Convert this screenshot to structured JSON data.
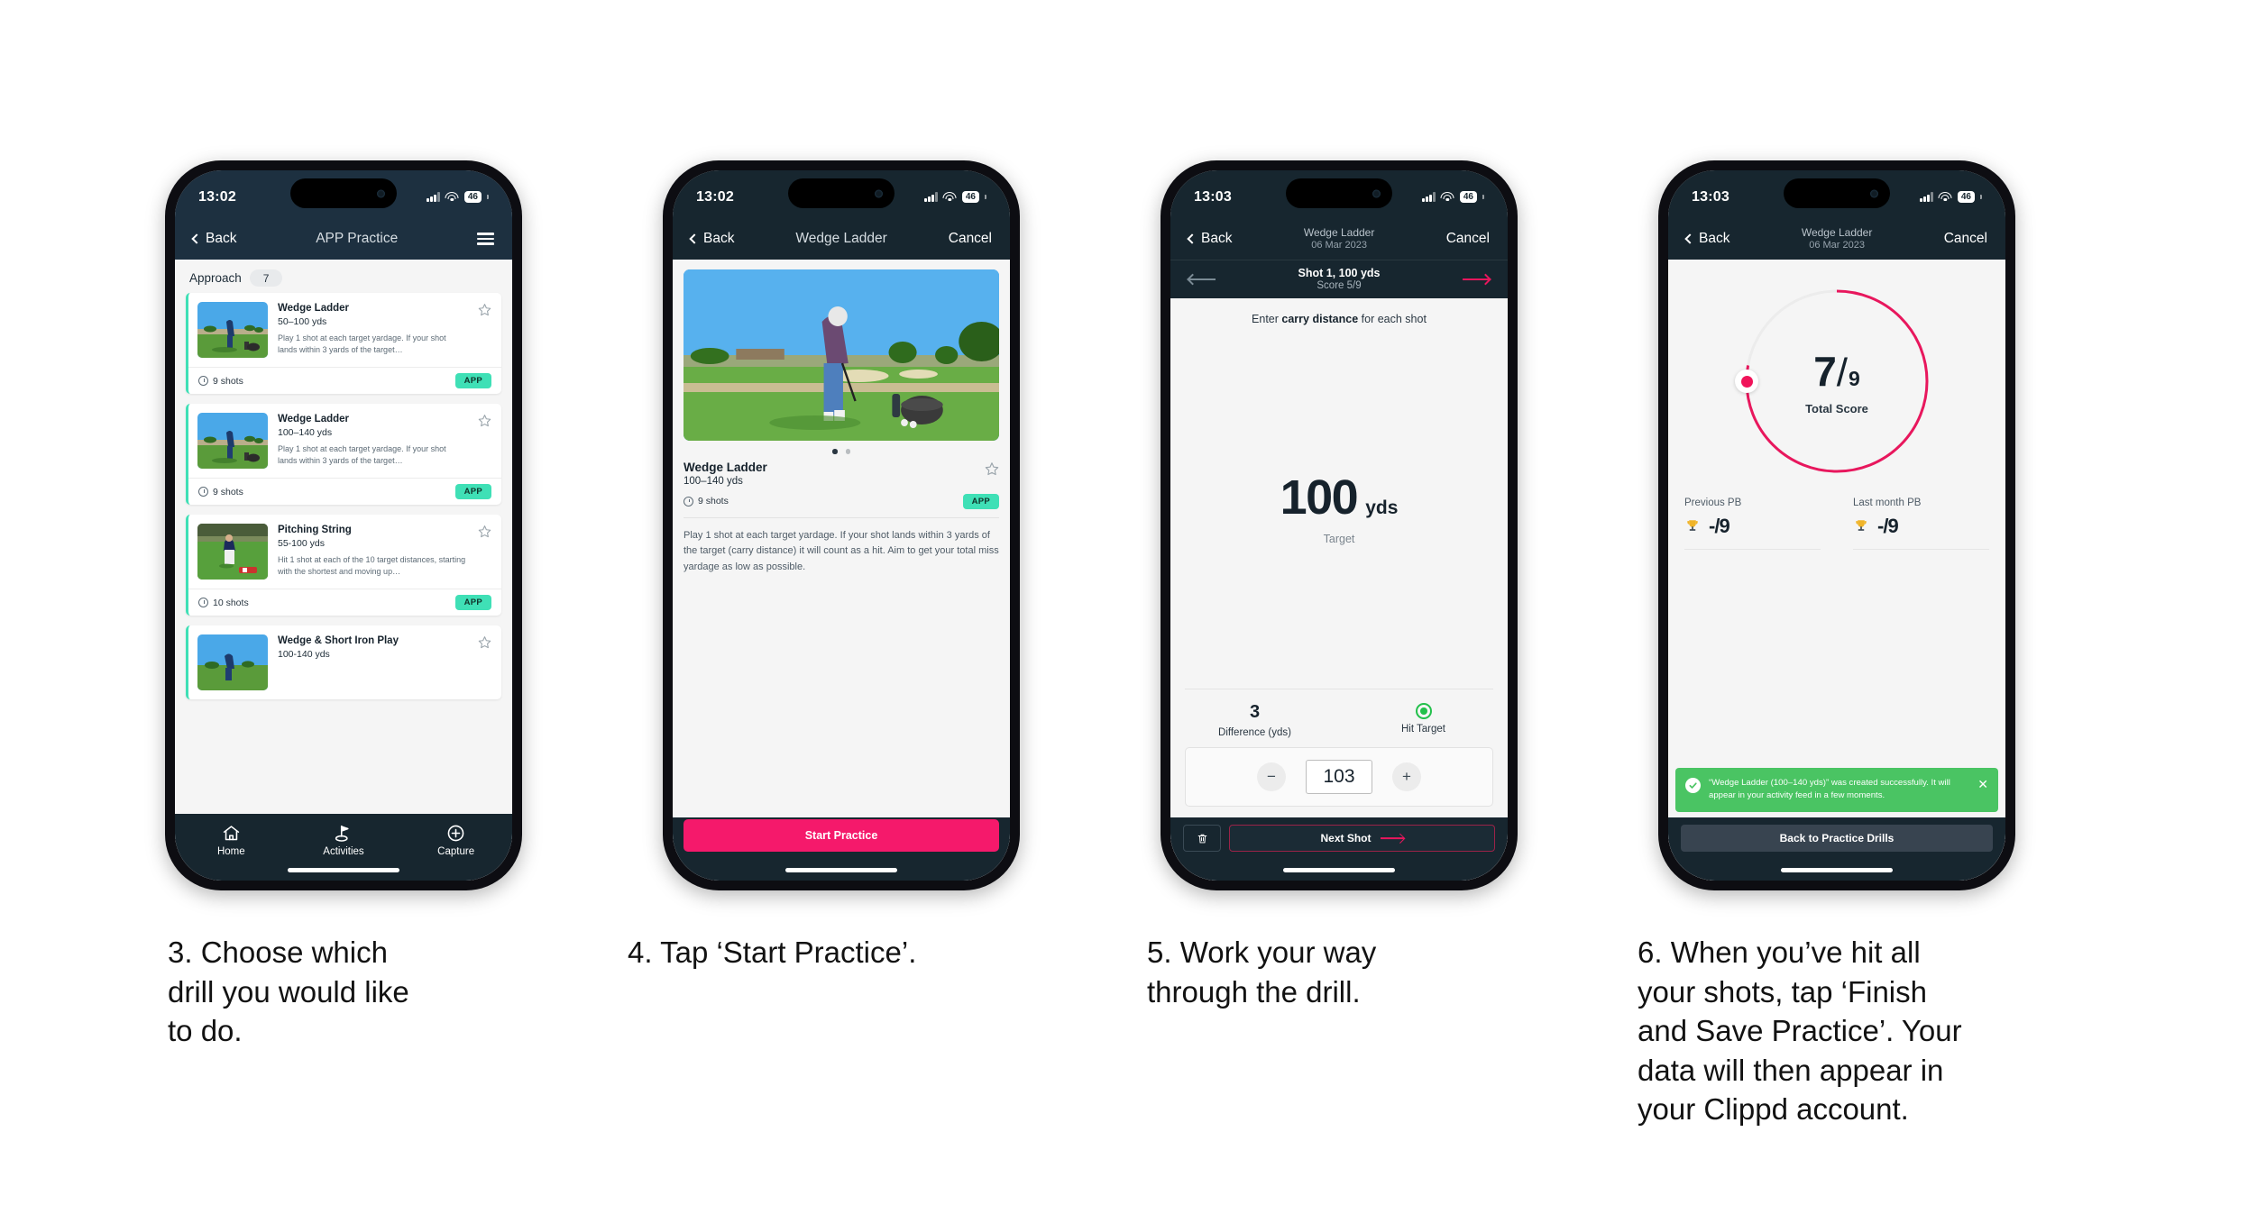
{
  "meta": {
    "accent_pink": "#f5196b",
    "accent_teal": "#3fe0b6",
    "navy": "#17262f",
    "green": "#4ac463"
  },
  "phones": [
    {
      "id": "phone-drill-list",
      "status": {
        "time": "13:02",
        "battery": "46"
      },
      "nav": {
        "back": "Back",
        "title": "APP Practice",
        "menu_icon": "hamburger-icon"
      },
      "filter": {
        "label": "Approach",
        "count": "7"
      },
      "cards": [
        {
          "title": "Wedge Ladder",
          "yards": "50–100 yds",
          "desc": "Play 1 shot at each target yardage. If your shot lands within 3 yards of the target…",
          "shots": "9 shots",
          "badge": "APP"
        },
        {
          "title": "Wedge Ladder",
          "yards": "100–140 yds",
          "desc": "Play 1 shot at each target yardage. If your shot lands within 3 yards of the target…",
          "shots": "9 shots",
          "badge": "APP"
        },
        {
          "title": "Pitching String",
          "yards": "55-100 yds",
          "desc": "Hit 1 shot at each of the 10 target distances, starting with the shortest and moving up…",
          "shots": "10 shots",
          "badge": "APP"
        },
        {
          "title": "Wedge & Short Iron Play",
          "yards": "100-140 yds",
          "desc": "",
          "shots": "",
          "badge": ""
        }
      ],
      "tabs": [
        {
          "label": "Home",
          "icon": "home-icon"
        },
        {
          "label": "Activities",
          "icon": "golf-flag-icon"
        },
        {
          "label": "Capture",
          "icon": "plus-circle-icon"
        }
      ]
    },
    {
      "id": "phone-drill-detail",
      "status": {
        "time": "13:02",
        "battery": "46"
      },
      "nav": {
        "back": "Back",
        "title": "Wedge Ladder",
        "cancel": "Cancel"
      },
      "carousel": {
        "slides": 2,
        "active": 0
      },
      "title": "Wedge Ladder",
      "yards": "100–140 yds",
      "shots": "9 shots",
      "badge": "APP",
      "description": "Play 1 shot at each target yardage. If your shot lands within 3 yards of the target (carry distance) it will count as a hit. Aim to get your total miss yardage as low as possible.",
      "cta": "Start Practice"
    },
    {
      "id": "phone-shot-entry",
      "status": {
        "time": "13:03",
        "battery": "46"
      },
      "nav": {
        "back": "Back",
        "title": "Wedge Ladder",
        "subtitle": "06 Mar 2023",
        "cancel": "Cancel"
      },
      "subhead": {
        "shot": "Shot 1, 100 yds",
        "score": "Score 5/9",
        "prev_icon": "arrow-left-icon",
        "next_icon": "arrow-right-icon"
      },
      "prompt_pre": "Enter ",
      "prompt_bold": "carry distance",
      "prompt_post": " for each shot",
      "target_value": "100",
      "target_unit": "yds",
      "target_caption": "Target",
      "stats": [
        {
          "value": "3",
          "label": "Difference (yds)"
        },
        {
          "value": "",
          "label": "Hit Target",
          "icon": "hit-target-icon"
        }
      ],
      "stepper": {
        "minus": "−",
        "value": "103",
        "plus": "+"
      },
      "footer": {
        "delete_icon": "trash-icon",
        "next": "Next Shot"
      }
    },
    {
      "id": "phone-summary",
      "status": {
        "time": "13:03",
        "battery": "46"
      },
      "nav": {
        "back": "Back",
        "title": "Wedge Ladder",
        "subtitle": "06 Mar 2023",
        "cancel": "Cancel"
      },
      "score": {
        "num": "7",
        "slash": "/",
        "den": "9",
        "label": "Total Score",
        "pct": 77.8
      },
      "pbs": [
        {
          "label": "Previous PB",
          "value": "-/9",
          "icon": "trophy-icon"
        },
        {
          "label": "Last month PB",
          "value": "-/9",
          "icon": "trophy-icon"
        }
      ],
      "toast": {
        "icon": "check-circle-icon",
        "message": "“Wedge Ladder (100–140 yds)” was created successfully. It will appear in your activity feed in a few moments.",
        "close": "✕"
      },
      "footer_button": "Back to Practice Drills"
    }
  ],
  "captions": [
    "3. Choose which\ndrill you would like\nto do.",
    "4. Tap ‘Start Practice’.",
    "5. Work your way\nthrough the drill.",
    "6. When you’ve hit all\nyour shots, tap ‘Finish\nand Save Practice’. Your\ndata will then appear in\nyour Clippd account."
  ]
}
